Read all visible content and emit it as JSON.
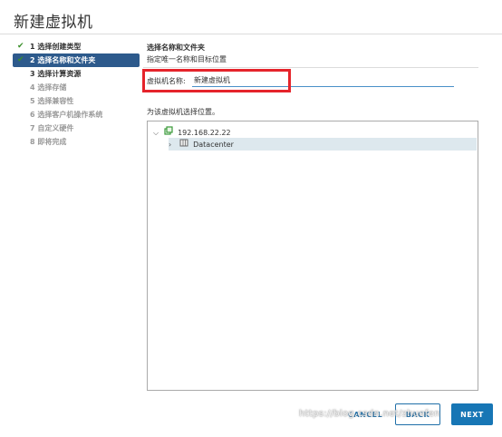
{
  "dialog": {
    "title": "新建虚拟机"
  },
  "steps": [
    {
      "label": "1 选择创建类型",
      "state": "done"
    },
    {
      "label": "2 选择名称和文件夹",
      "state": "active"
    },
    {
      "label": "3 选择计算资源",
      "state": "current"
    },
    {
      "label": "4 选择存储",
      "state": "disabled"
    },
    {
      "label": "5 选择兼容性",
      "state": "disabled"
    },
    {
      "label": "6 选择客户机操作系统",
      "state": "disabled"
    },
    {
      "label": "7 自定义硬件",
      "state": "disabled"
    },
    {
      "label": "8 即将完成",
      "state": "disabled"
    }
  ],
  "content": {
    "heading": "选择名称和文件夹",
    "subheading": "指定唯一名称和目标位置",
    "name_label": "虚拟机名称:",
    "name_value": "新建虚拟机",
    "location_label": "为该虚拟机选择位置。"
  },
  "tree": {
    "root": {
      "label": "192.168.22.22",
      "expanded": true,
      "icon": "host-icon"
    },
    "child": {
      "label": "Datacenter",
      "expanded": false,
      "icon": "datacenter-icon",
      "selected": true
    }
  },
  "buttons": {
    "cancel": "CANCEL",
    "back": "BACK",
    "next": "NEXT"
  },
  "watermark": "https://blog.csdn.net/zhuofen",
  "colors": {
    "accent": "#1776b5",
    "active_step": "#2d5a8c",
    "check": "#3a8f2a",
    "highlight": "#e5242b"
  }
}
